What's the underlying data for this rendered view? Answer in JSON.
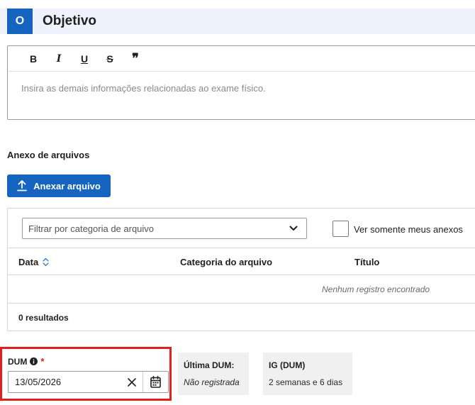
{
  "section": {
    "letter": "O",
    "title": "Objetivo"
  },
  "editor": {
    "toolbar": {
      "bold": "B",
      "italic": "I",
      "underline": "U",
      "strike": "S",
      "quote": "❞"
    },
    "placeholder": "Insira as demais informações relacionadas ao exame físico."
  },
  "attachments": {
    "label": "Anexo de arquivos",
    "button_label": "Anexar arquivo",
    "filter_placeholder": "Filtrar por categoria de arquivo",
    "only_mine_label": "Ver somente meus anexos",
    "only_mine_checked": false,
    "columns": [
      "Data",
      "Categoria do arquivo",
      "Título"
    ],
    "empty_message": "Nenhum registro encontrado",
    "results": "0 resultados"
  },
  "dum": {
    "label": "DUM",
    "required_mark": "*",
    "value": "13/05/2026"
  },
  "ultima_dum": {
    "title": "Última DUM:",
    "value": "Não registrada"
  },
  "ig_dum": {
    "title": "IG (DUM)",
    "value": "2 semanas e 6 dias"
  },
  "colors": {
    "accent": "#1565c0",
    "highlight_border": "#e0201e",
    "required": "#d0201e"
  }
}
